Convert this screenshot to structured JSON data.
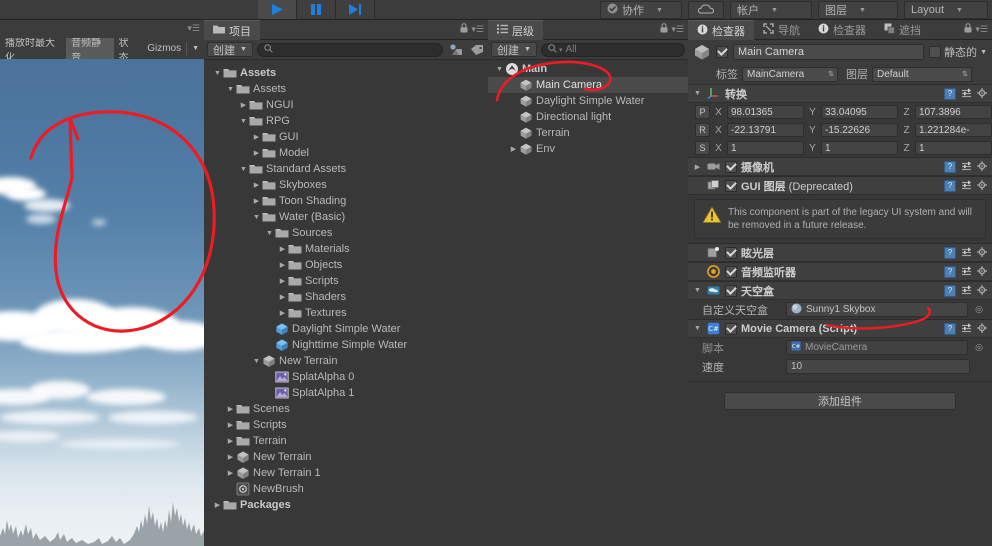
{
  "toolbar": {
    "play_icons": [
      "play-icon",
      "pause-icon",
      "step-icon"
    ],
    "buttons": [
      {
        "label": "协作",
        "icon": "cloud-check-icon",
        "name": "collab-button",
        "caret": true
      },
      {
        "label": "",
        "icon": "cloud-icon",
        "name": "cloud-button",
        "caret": false
      },
      {
        "label": "帐户",
        "icon": "",
        "name": "account-button",
        "caret": true
      },
      {
        "label": "图层",
        "icon": "",
        "name": "layers-button",
        "caret": true
      },
      {
        "label": "Layout",
        "icon": "",
        "name": "layout-button",
        "caret": true
      }
    ]
  },
  "scene": {
    "toolbar": [
      {
        "label": "播放时最大化",
        "active": false
      },
      {
        "label": "音频静音",
        "active": true
      },
      {
        "label": "状态",
        "active": false
      },
      {
        "label": "Gizmos",
        "active": false
      }
    ],
    "gizmos_caret": "▾",
    "menu_icon": "panel-menu-icon"
  },
  "project": {
    "tab": "项目",
    "tab_icon": "folder-icon",
    "create_label": "创建",
    "search_placeholder": "",
    "search_value": "",
    "lock_icon": "lock-icon",
    "menu_icon": "panel-menu-icon",
    "tree": [
      {
        "label": "Assets",
        "indent": 0,
        "arrow": "down",
        "icon": "folder",
        "bold": true
      },
      {
        "label": "Assets",
        "indent": 1,
        "arrow": "down",
        "icon": "folder"
      },
      {
        "label": "NGUI",
        "indent": 2,
        "arrow": "right",
        "icon": "folder"
      },
      {
        "label": "RPG",
        "indent": 2,
        "arrow": "down",
        "icon": "folder"
      },
      {
        "label": "GUI",
        "indent": 3,
        "arrow": "right",
        "icon": "folder"
      },
      {
        "label": "Model",
        "indent": 3,
        "arrow": "right",
        "icon": "folder"
      },
      {
        "label": "Standard Assets",
        "indent": 2,
        "arrow": "down",
        "icon": "folder"
      },
      {
        "label": "Skyboxes",
        "indent": 3,
        "arrow": "right",
        "icon": "folder"
      },
      {
        "label": "Toon Shading",
        "indent": 3,
        "arrow": "right",
        "icon": "folder"
      },
      {
        "label": "Water (Basic)",
        "indent": 3,
        "arrow": "down",
        "icon": "folder"
      },
      {
        "label": "Sources",
        "indent": 4,
        "arrow": "down",
        "icon": "folder"
      },
      {
        "label": "Materials",
        "indent": 5,
        "arrow": "right",
        "icon": "folder"
      },
      {
        "label": "Objects",
        "indent": 5,
        "arrow": "right",
        "icon": "folder"
      },
      {
        "label": "Scripts",
        "indent": 5,
        "arrow": "right",
        "icon": "folder"
      },
      {
        "label": "Shaders",
        "indent": 5,
        "arrow": "right",
        "icon": "folder"
      },
      {
        "label": "Textures",
        "indent": 5,
        "arrow": "right",
        "icon": "folder"
      },
      {
        "label": "Daylight Simple Water",
        "indent": 4,
        "arrow": "none",
        "icon": "prefab"
      },
      {
        "label": "Nighttime Simple Water",
        "indent": 4,
        "arrow": "none",
        "icon": "prefab"
      },
      {
        "label": "New Terrain",
        "indent": 3,
        "arrow": "down",
        "icon": "model"
      },
      {
        "label": "SplatAlpha 0",
        "indent": 4,
        "arrow": "none",
        "icon": "texture"
      },
      {
        "label": "SplatAlpha 1",
        "indent": 4,
        "arrow": "none",
        "icon": "texture"
      },
      {
        "label": "Scenes",
        "indent": 1,
        "arrow": "right",
        "icon": "folder"
      },
      {
        "label": "Scripts",
        "indent": 1,
        "arrow": "right",
        "icon": "folder"
      },
      {
        "label": "Terrain",
        "indent": 1,
        "arrow": "right",
        "icon": "folder"
      },
      {
        "label": "New Terrain",
        "indent": 1,
        "arrow": "right",
        "icon": "model"
      },
      {
        "label": "New Terrain 1",
        "indent": 1,
        "arrow": "right",
        "icon": "model"
      },
      {
        "label": "NewBrush",
        "indent": 1,
        "arrow": "none",
        "icon": "brush"
      },
      {
        "label": "Packages",
        "indent": 0,
        "arrow": "right",
        "icon": "folder",
        "bold": true
      }
    ]
  },
  "hierarchy": {
    "tab": "层级",
    "tab_icon": "hierarchy-icon",
    "create_label": "创建",
    "search_placeholder": "All",
    "lock_icon": "lock-icon",
    "menu_icon": "panel-menu-icon",
    "tree": [
      {
        "label": "Main",
        "indent": 0,
        "arrow": "down",
        "icon": "scene",
        "bold": true
      },
      {
        "label": "Main Camera",
        "indent": 1,
        "arrow": "none",
        "icon": "gameobject",
        "selected": true
      },
      {
        "label": "Daylight Simple Water",
        "indent": 1,
        "arrow": "none",
        "icon": "gameobject"
      },
      {
        "label": "Directional light",
        "indent": 1,
        "arrow": "none",
        "icon": "gameobject"
      },
      {
        "label": "Terrain",
        "indent": 1,
        "arrow": "none",
        "icon": "gameobject"
      },
      {
        "label": "Env",
        "indent": 1,
        "arrow": "right",
        "icon": "gameobject"
      }
    ]
  },
  "inspector": {
    "tabs": [
      {
        "label": "检查器",
        "icon": "info-icon",
        "active": true,
        "name": "tab-inspector"
      },
      {
        "label": "导航",
        "icon": "navigation-icon",
        "active": false,
        "name": "tab-navigation"
      },
      {
        "label": "检查器",
        "icon": "info-icon",
        "active": false,
        "name": "tab-inspector-2"
      },
      {
        "label": "遮挡",
        "icon": "occlusion-icon",
        "active": false,
        "name": "tab-occlusion"
      }
    ],
    "lock_icon": "lock-icon",
    "menu_icon": "panel-menu-icon",
    "object": {
      "name": "Main Camera",
      "enabled": true,
      "icon": "gameobject-icon",
      "static_label": "静态的",
      "static_checked": false
    },
    "tag": {
      "label": "标签",
      "value": "MainCamera"
    },
    "layer": {
      "label": "图层",
      "value": "Default"
    },
    "transform": {
      "title": "转换",
      "icon": "transform-icon",
      "rows": [
        {
          "badge": "P",
          "x": "98.01365",
          "y": "33.04095",
          "z": "107.3896"
        },
        {
          "badge": "R",
          "x": "-22.13791",
          "y": "-15.22626",
          "z": "1.221284e-"
        },
        {
          "badge": "S",
          "x": "1",
          "y": "1",
          "z": "1"
        }
      ],
      "axis_labels": [
        "X",
        "Y",
        "Z"
      ]
    },
    "components": [
      {
        "name": "comp-camera",
        "title": "摄像机",
        "icon": "camera-icon",
        "enabled": true,
        "arrow": "right",
        "deprecated": ""
      },
      {
        "name": "comp-gui-layer",
        "title": "GUI 图层",
        "icon": "gui-layer-icon",
        "enabled": true,
        "arrow": "none",
        "deprecated": " (Deprecated)"
      },
      {
        "name": "comp-flare-layer",
        "title": "眩光层",
        "icon": "flare-icon",
        "enabled": true,
        "arrow": "none",
        "deprecated": ""
      },
      {
        "name": "comp-audio-listener",
        "title": "音频监听器",
        "icon": "audio-listener-icon",
        "enabled": true,
        "arrow": "none",
        "deprecated": ""
      },
      {
        "name": "comp-skybox",
        "title": "天空盒",
        "icon": "skybox-icon",
        "enabled": true,
        "arrow": "down",
        "deprecated": ""
      },
      {
        "name": "comp-movie-camera",
        "title": "Movie Camera (Script)",
        "icon": "script-icon",
        "enabled": true,
        "arrow": "down",
        "deprecated": ""
      }
    ],
    "gui_layer_warning": "This component is part of the legacy UI system and will be removed in a future release.",
    "skybox": {
      "prop_label": "自定义天空盒",
      "value": "Sunny1 Skybox",
      "value_icon": "material-icon"
    },
    "movie_camera": {
      "script_label": "脚本",
      "script_value": "MovieCamera",
      "script_icon": "script-asset-icon",
      "speed_label": "速度",
      "speed_value": "10"
    },
    "add_component_label": "添加组件"
  },
  "annotations": {
    "color": "#ed1c24",
    "shapes": [
      "scene-circle",
      "hierarchy-circle",
      "skybox-underline"
    ]
  },
  "colors": {
    "panel_bg": "#383838",
    "toolbar_bg": "#3c3c3c",
    "selection": "#4b4b4b",
    "accent_blue": "#3d7fd6",
    "annotation_red": "#ed1c24",
    "warning_yellow": "#e8c33a"
  }
}
